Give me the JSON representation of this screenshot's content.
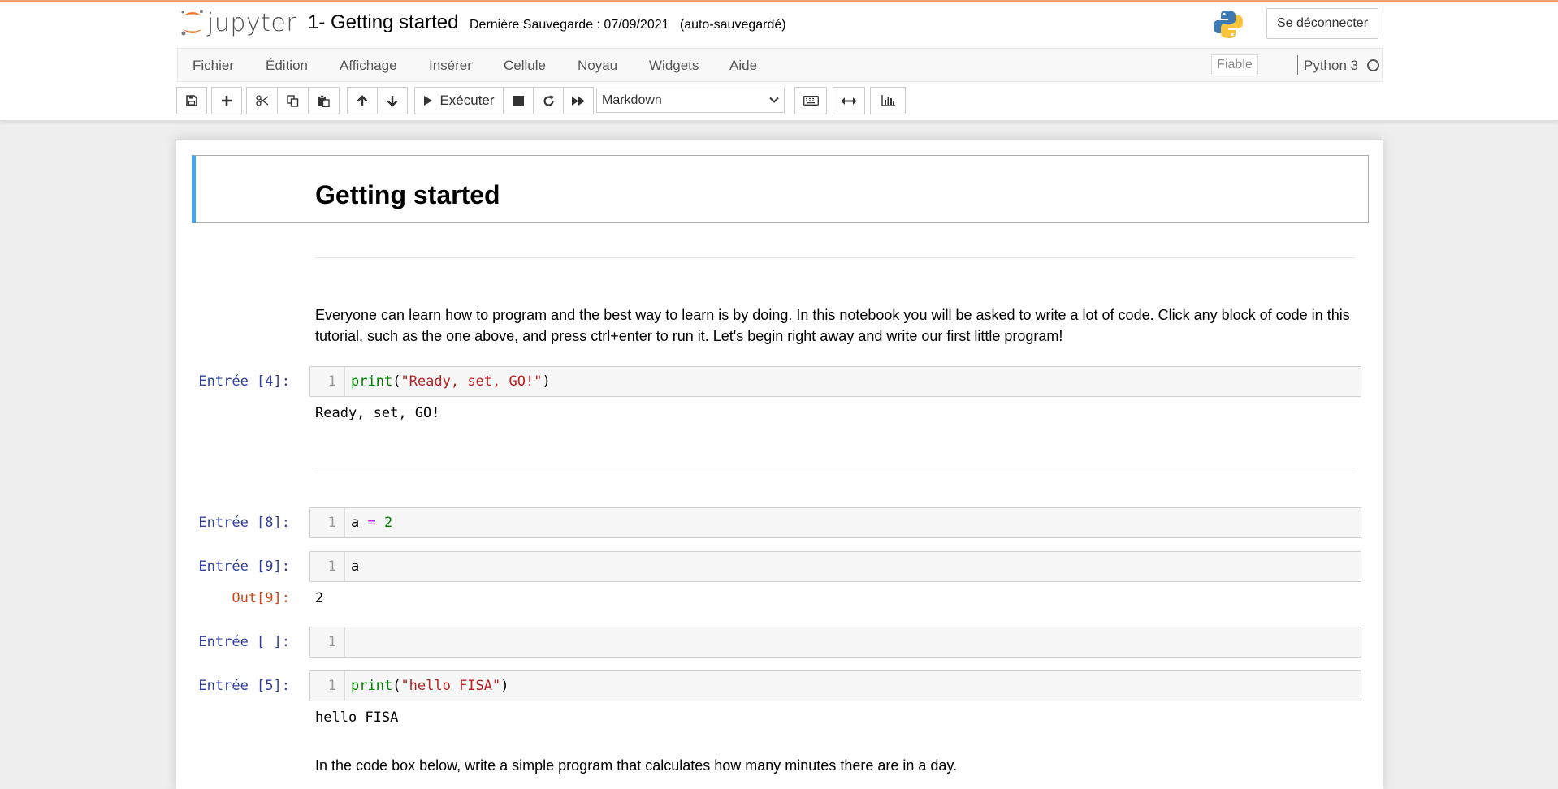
{
  "header": {
    "logo_text": "jupyter",
    "notebook_title": "1- Getting started",
    "save_info": "Dernière Sauvegarde : 07/09/2021",
    "autosave": "(auto-sauvegardé)",
    "logout_label": "Se déconnecter"
  },
  "menubar": {
    "items": [
      "Fichier",
      "Édition",
      "Affichage",
      "Insérer",
      "Cellule",
      "Noyau",
      "Widgets",
      "Aide"
    ],
    "trusted": "Fiable",
    "kernel": "Python 3"
  },
  "toolbar": {
    "run_label": "Exécuter",
    "cell_type": "Markdown",
    "icons": [
      "save-icon",
      "plus-icon",
      "cut-icon",
      "copy-icon",
      "paste-icon",
      "arrow-up-icon",
      "arrow-down-icon",
      "play-icon",
      "stop-icon",
      "restart-icon",
      "fast-forward-icon",
      "keyboard-icon",
      "arrows-h-icon",
      "bar-chart-icon"
    ]
  },
  "notebook": {
    "heading": "Getting started",
    "intro_paragraph": "Everyone can learn how to program and the best way to learn is by doing. In this notebook you will be asked to write a lot of code. Click any block of code in this tutorial, such as the one above, and press ctrl+enter to run it. Let's begin right away and write our first little program!",
    "cells": [
      {
        "prompt": "Entrée [4]:",
        "line": "1",
        "code_fn": "print",
        "code_open": "(",
        "code_str": "\"Ready, set, GO!\"",
        "code_close": ")",
        "output": "Ready, set, GO!"
      },
      {
        "prompt": "Entrée [8]:",
        "line": "1",
        "code_var": "a",
        "code_op": "=",
        "code_num": "2"
      },
      {
        "prompt": "Entrée [9]:",
        "line": "1",
        "code": "a",
        "out_prompt": "Out[9]:",
        "output": "2"
      },
      {
        "prompt": "Entrée [ ]:",
        "line": "1",
        "code": ""
      },
      {
        "prompt": "Entrée [5]:",
        "line": "1",
        "code_fn": "print",
        "code_open": "(",
        "code_str": "\"hello FISA\"",
        "code_close": ")",
        "output": "hello FISA"
      }
    ],
    "closing_paragraph": "In the code box below, write a simple program that calculates how many minutes there are in a day."
  },
  "colors": {
    "accent_blue": "#42a5f5",
    "prompt_in": "#303f9f",
    "prompt_out": "#d84315",
    "jupyter_orange": "#f37726"
  }
}
